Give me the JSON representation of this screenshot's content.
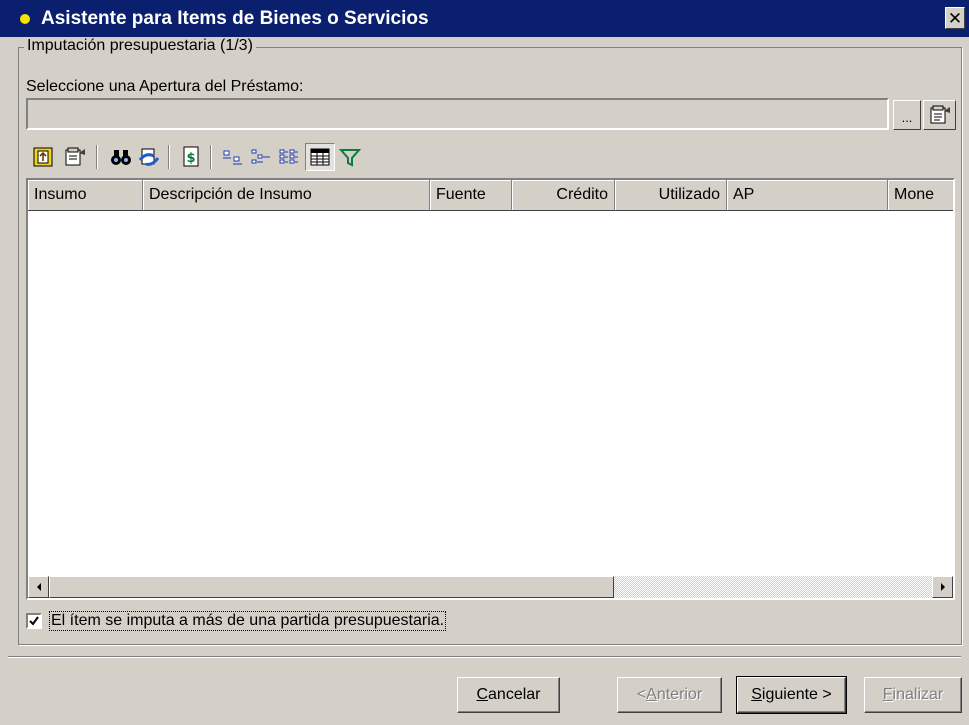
{
  "window": {
    "title": "Asistente para Items de Bienes o Servicios",
    "close_glyph": "✕"
  },
  "group": {
    "legend": "Imputación presupuestaria (1/3)"
  },
  "apertura": {
    "label": "Seleccione una Apertura del Préstamo:",
    "value": "",
    "browse_label": "..."
  },
  "toolbar": {
    "icons": [
      "details-icon",
      "properties-icon",
      "find-icon",
      "refresh-data-icon",
      "recalculate-icon",
      "view-small-icons-icon",
      "view-list-icon",
      "view-details-icon",
      "view-grid-icon",
      "filter-icon"
    ],
    "pressed": "view-grid-icon"
  },
  "grid": {
    "columns": [
      "Insumo",
      "Descripción de Insumo",
      "Fuente",
      "Crédito",
      "Utilizado",
      "AP",
      "Mone"
    ],
    "rows": []
  },
  "options": {
    "multi_partida_checked": true,
    "multi_partida_label": "El ítem se imputa a más de una partida presupuestaria."
  },
  "buttons": {
    "cancel_u": "C",
    "cancel_rest": "ancelar",
    "back_pre": "< ",
    "back_u": "A",
    "back_rest": "nterior",
    "next_u": "S",
    "next_rest": "iguiente >",
    "finish_u": "F",
    "finish_rest": "inalizar"
  },
  "colors": {
    "titlebar": "#0a1f6e",
    "title_dot": "#f4e400",
    "face": "#d4d0c8",
    "filter_icon": "#0a7d3a"
  }
}
